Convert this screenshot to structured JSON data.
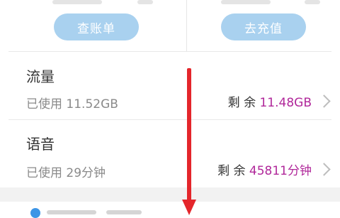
{
  "top_actions": {
    "bill_button": "查账单",
    "recharge_button": "去充值"
  },
  "data_row": {
    "title": "流量",
    "used_label": "已使用",
    "used_value": "11.52GB",
    "remain_label": "剩 余",
    "remain_value": "11.48GB"
  },
  "voice_row": {
    "title": "语音",
    "used_label": "已使用",
    "used_value": "29分钟",
    "remain_label": "剩 余",
    "remain_value": "45811分钟"
  },
  "colors": {
    "accent_button": "#a9d1ef",
    "remain_highlight": "#b0279a",
    "annotation_arrow": "#e4262b"
  }
}
